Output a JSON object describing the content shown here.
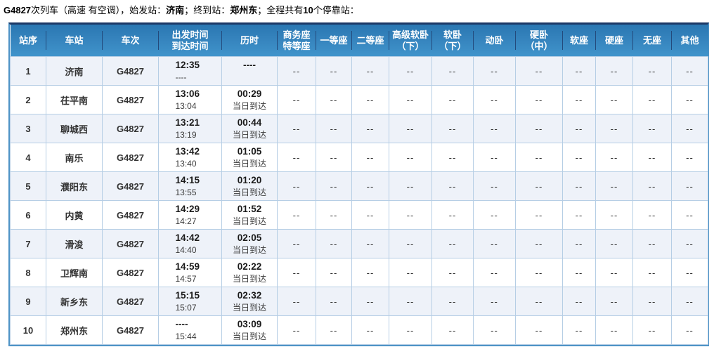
{
  "title": {
    "train_no": "G4827",
    "seg1": "次列车（高速 有空调），始发站：",
    "origin": "济南",
    "seg2": "；终到站：",
    "terminal": "郑州东",
    "seg3": "；全程共有",
    "stop_count": "10",
    "seg4": "个停靠站："
  },
  "colors": {
    "header_gradient_top": "#2a77b2",
    "header_gradient_bottom": "#4094cb",
    "header_top_bar": "#1c3866",
    "header_divider": "#234a7c",
    "header_text": "#ffffff",
    "outer_border": "#4e93c6",
    "grid_line": "#b6cee5",
    "row_alt_background": "#eef2f9",
    "dash_text": "#8a94a2"
  },
  "table": {
    "columns": [
      {
        "key": "seq",
        "label_lines": [
          "站序"
        ]
      },
      {
        "key": "station",
        "label_lines": [
          "车站"
        ]
      },
      {
        "key": "train",
        "label_lines": [
          "车次"
        ]
      },
      {
        "key": "time",
        "label_lines": [
          "出发时间",
          "到达时间"
        ]
      },
      {
        "key": "duration",
        "label_lines": [
          "历时"
        ]
      },
      {
        "key": "business-special-seat",
        "label_lines": [
          "商务座",
          "特等座"
        ]
      },
      {
        "key": "first-class-seat",
        "label_lines": [
          "一等座"
        ]
      },
      {
        "key": "second-class-seat",
        "label_lines": [
          "二等座"
        ]
      },
      {
        "key": "premium-soft-sleeper",
        "label_lines": [
          "高级软卧",
          "（下）"
        ]
      },
      {
        "key": "soft-sleeper",
        "label_lines": [
          "软卧",
          "（下）"
        ]
      },
      {
        "key": "emu-sleeper",
        "label_lines": [
          "动卧"
        ]
      },
      {
        "key": "hard-sleeper",
        "label_lines": [
          "硬卧",
          "（中）"
        ]
      },
      {
        "key": "soft-seat",
        "label_lines": [
          "软座"
        ]
      },
      {
        "key": "hard-seat",
        "label_lines": [
          "硬座"
        ]
      },
      {
        "key": "no-seat",
        "label_lines": [
          "无座"
        ]
      },
      {
        "key": "other",
        "label_lines": [
          "其他"
        ]
      }
    ],
    "rows": [
      {
        "seq": "1",
        "station": "济南",
        "train": "G4827",
        "depart": "12:35",
        "arrive": "----",
        "duration": "----",
        "duration_note": "",
        "seats": [
          "--",
          "--",
          "--",
          "--",
          "--",
          "--",
          "--",
          "--",
          "--",
          "--",
          "--"
        ]
      },
      {
        "seq": "2",
        "station": "茌平南",
        "train": "G4827",
        "depart": "13:06",
        "arrive": "13:04",
        "duration": "00:29",
        "duration_note": "当日到达",
        "seats": [
          "--",
          "--",
          "--",
          "--",
          "--",
          "--",
          "--",
          "--",
          "--",
          "--",
          "--"
        ]
      },
      {
        "seq": "3",
        "station": "聊城西",
        "train": "G4827",
        "depart": "13:21",
        "arrive": "13:19",
        "duration": "00:44",
        "duration_note": "当日到达",
        "seats": [
          "--",
          "--",
          "--",
          "--",
          "--",
          "--",
          "--",
          "--",
          "--",
          "--",
          "--"
        ]
      },
      {
        "seq": "4",
        "station": "南乐",
        "train": "G4827",
        "depart": "13:42",
        "arrive": "13:40",
        "duration": "01:05",
        "duration_note": "当日到达",
        "seats": [
          "--",
          "--",
          "--",
          "--",
          "--",
          "--",
          "--",
          "--",
          "--",
          "--",
          "--"
        ]
      },
      {
        "seq": "5",
        "station": "濮阳东",
        "train": "G4827",
        "depart": "14:15",
        "arrive": "13:55",
        "duration": "01:20",
        "duration_note": "当日到达",
        "seats": [
          "--",
          "--",
          "--",
          "--",
          "--",
          "--",
          "--",
          "--",
          "--",
          "--",
          "--"
        ]
      },
      {
        "seq": "6",
        "station": "内黄",
        "train": "G4827",
        "depart": "14:29",
        "arrive": "14:27",
        "duration": "01:52",
        "duration_note": "当日到达",
        "seats": [
          "--",
          "--",
          "--",
          "--",
          "--",
          "--",
          "--",
          "--",
          "--",
          "--",
          "--"
        ]
      },
      {
        "seq": "7",
        "station": "滑浚",
        "train": "G4827",
        "depart": "14:42",
        "arrive": "14:40",
        "duration": "02:05",
        "duration_note": "当日到达",
        "seats": [
          "--",
          "--",
          "--",
          "--",
          "--",
          "--",
          "--",
          "--",
          "--",
          "--",
          "--"
        ]
      },
      {
        "seq": "8",
        "station": "卫辉南",
        "train": "G4827",
        "depart": "14:59",
        "arrive": "14:57",
        "duration": "02:22",
        "duration_note": "当日到达",
        "seats": [
          "--",
          "--",
          "--",
          "--",
          "--",
          "--",
          "--",
          "--",
          "--",
          "--",
          "--"
        ]
      },
      {
        "seq": "9",
        "station": "新乡东",
        "train": "G4827",
        "depart": "15:15",
        "arrive": "15:07",
        "duration": "02:32",
        "duration_note": "当日到达",
        "seats": [
          "--",
          "--",
          "--",
          "--",
          "--",
          "--",
          "--",
          "--",
          "--",
          "--",
          "--"
        ]
      },
      {
        "seq": "10",
        "station": "郑州东",
        "train": "G4827",
        "depart": "----",
        "arrive": "15:44",
        "duration": "03:09",
        "duration_note": "当日到达",
        "seats": [
          "--",
          "--",
          "--",
          "--",
          "--",
          "--",
          "--",
          "--",
          "--",
          "--",
          "--"
        ]
      }
    ]
  }
}
